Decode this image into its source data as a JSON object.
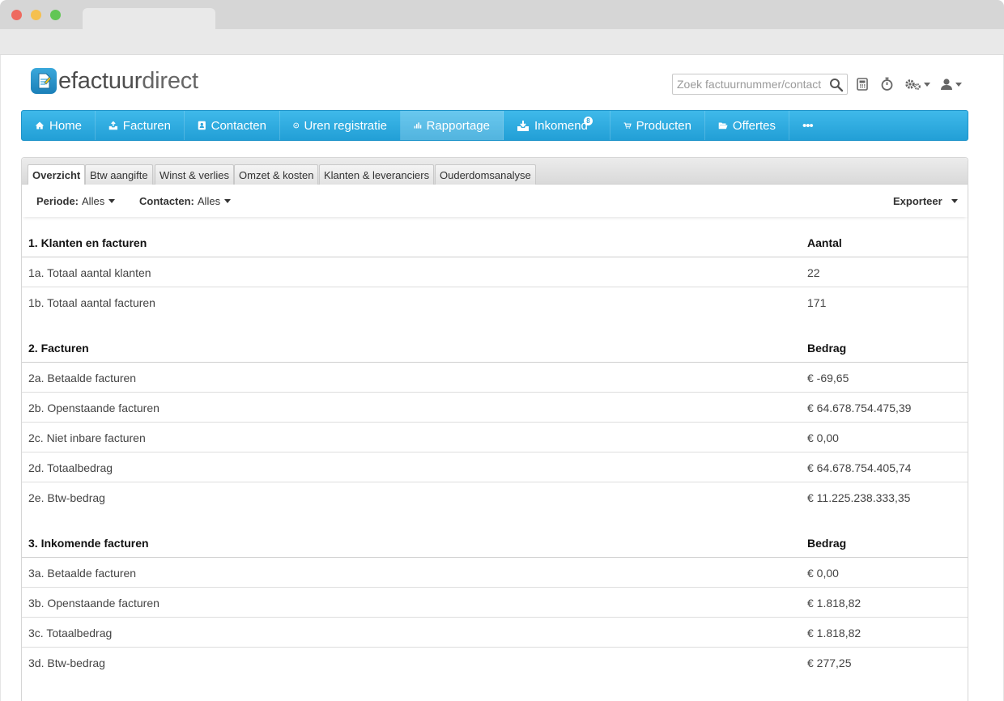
{
  "brand": {
    "logo_part1": "efactuur",
    "logo_part2": "direct"
  },
  "search": {
    "placeholder": "Zoek factuurnummer/contact"
  },
  "nav": {
    "items": [
      {
        "label": "Home",
        "icon": "home-icon"
      },
      {
        "label": "Facturen",
        "icon": "inbox-upload-icon"
      },
      {
        "label": "Contacten",
        "icon": "contact-card-icon"
      },
      {
        "label": "Uren registratie",
        "icon": "clock-check-icon"
      },
      {
        "label": "Rapportage",
        "icon": "bar-chart-icon",
        "active": true
      },
      {
        "label": "Inkomend",
        "icon": "inbox-download-icon",
        "badge": "8"
      },
      {
        "label": "Producten",
        "icon": "cart-icon"
      },
      {
        "label": "Offertes",
        "icon": "folder-open-icon"
      },
      {
        "label": "•••",
        "icon": "more-icon"
      }
    ]
  },
  "report_tabs": [
    "Overzicht",
    "Btw aangifte",
    "Winst & verlies",
    "Omzet & kosten",
    "Klanten & leveranciers",
    "Ouderdomsanalyse"
  ],
  "filters": {
    "periode_label": "Periode:",
    "periode_value": "Alles",
    "contacten_label": "Contacten:",
    "contacten_value": "Alles",
    "export_label": "Exporteer"
  },
  "sections": [
    {
      "title": "1. Klanten en facturen",
      "column": "Aantal",
      "rows": [
        {
          "label": "1a. Totaal aantal klanten",
          "value": "22"
        },
        {
          "label": "1b. Totaal aantal facturen",
          "value": "171"
        }
      ]
    },
    {
      "title": "2. Facturen",
      "column": "Bedrag",
      "rows": [
        {
          "label": "2a. Betaalde facturen",
          "value": "€ -69,65"
        },
        {
          "label": "2b. Openstaande facturen",
          "value": "€ 64.678.754.475,39"
        },
        {
          "label": "2c. Niet inbare facturen",
          "value": "€ 0,00"
        },
        {
          "label": "2d. Totaalbedrag",
          "value": "€ 64.678.754.405,74"
        },
        {
          "label": "2e. Btw-bedrag",
          "value": "€ 11.225.238.333,35"
        }
      ]
    },
    {
      "title": "3. Inkomende facturen",
      "column": "Bedrag",
      "rows": [
        {
          "label": "3a. Betaalde facturen",
          "value": "€ 0,00"
        },
        {
          "label": "3b. Openstaande facturen",
          "value": "€ 1.818,82"
        },
        {
          "label": "3c. Totaalbedrag",
          "value": "€ 1.818,82"
        },
        {
          "label": "3d. Btw-bedrag",
          "value": "€ 277,25"
        }
      ]
    }
  ],
  "colors": {
    "nav_top": "#3fb9ea",
    "nav_bottom": "#229fd6"
  }
}
